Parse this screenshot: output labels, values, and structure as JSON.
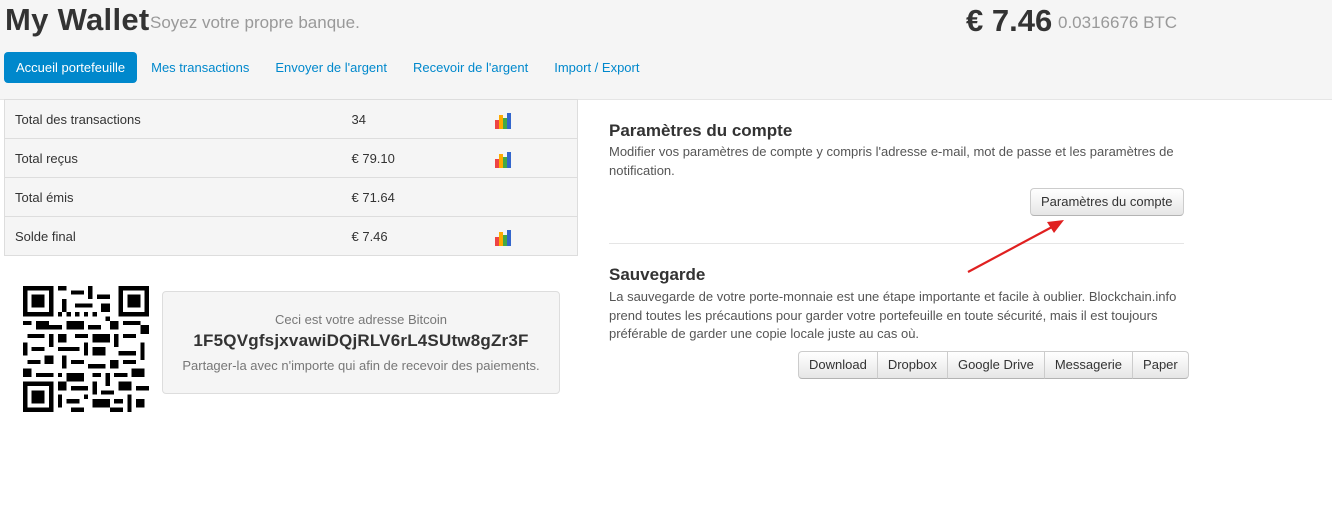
{
  "header": {
    "title": "My Wallet",
    "tagline": "Soyez votre propre banque.",
    "balance": "€ 7.46",
    "balance_btc": "0.0316676 BTC"
  },
  "nav": {
    "items": [
      {
        "label": "Accueil portefeuille",
        "active": true
      },
      {
        "label": "Mes transactions"
      },
      {
        "label": "Envoyer de l'argent"
      },
      {
        "label": "Recevoir de l'argent"
      },
      {
        "label": "Import / Export"
      }
    ]
  },
  "stats": {
    "rows": [
      {
        "label": "Total des transactions",
        "value": "34",
        "chart_icon": true
      },
      {
        "label": "Total reçus",
        "value": "€ 79.10",
        "chart_icon": true
      },
      {
        "label": "Total émis",
        "value": "€ 71.64",
        "chart_icon": false
      },
      {
        "label": "Solde final",
        "value": "€ 7.46",
        "chart_icon": true
      }
    ]
  },
  "address": {
    "caption": "Ceci est votre adresse Bitcoin",
    "value": "1F5QVgfsjxvawiDQjRLV6rL4SUtw8gZr3F",
    "hint": "Partager-la avec n'importe qui afin de recevoir des paiements."
  },
  "account": {
    "title": "Paramètres du compte",
    "description": "Modifier vos paramètres de compte y compris l'adresse e-mail, mot de passe et les paramètres de notification.",
    "button": "Paramètres du compte"
  },
  "backup": {
    "title": "Sauvegarde",
    "description": "La sauvegarde de votre porte-monnaie est une étape importante et facile à oublier. Blockchain.info prend toutes les précautions pour garder votre portefeuille en toute sécurité, mais il est toujours préférable de garder une copie locale juste au cas où.",
    "buttons": [
      "Download",
      "Dropbox",
      "Google Drive",
      "Messagerie",
      "Paper"
    ]
  },
  "colors": {
    "accent": "#0088cc",
    "annotation_arrow": "#e02020"
  },
  "icons": {
    "stats_chart": "bar-chart-icon",
    "qr": "qr-code-icon"
  }
}
